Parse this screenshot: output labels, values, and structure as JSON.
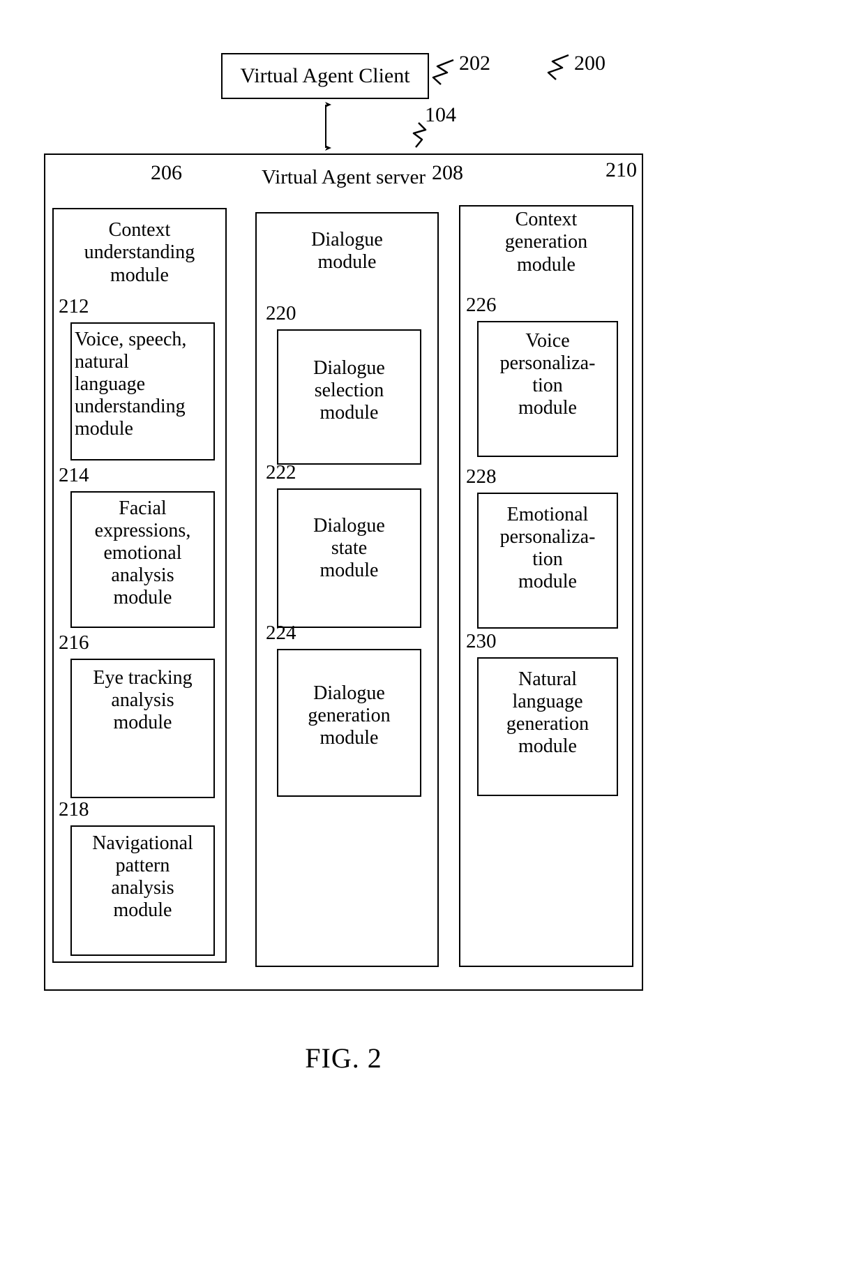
{
  "figure": {
    "caption": "FIG. 2",
    "system_ref": "200"
  },
  "client": {
    "label": "Virtual Agent Client",
    "ref": "202"
  },
  "link": {
    "ref": "104"
  },
  "server": {
    "title": "Virtual Agent server",
    "columns": [
      {
        "ref": "206",
        "title": "Context\nunderstanding\nmodule",
        "submodules": [
          {
            "ref": "212",
            "label": "Voice, speech,\nnatural\nlanguage\nunderstanding\nmodule"
          },
          {
            "ref": "214",
            "label": "Facial\nexpressions,\nemotional\nanalysis\nmodule"
          },
          {
            "ref": "216",
            "label": "Eye tracking\nanalysis\nmodule"
          },
          {
            "ref": "218",
            "label": "Navigational\npattern\nanalysis\nmodule"
          }
        ]
      },
      {
        "ref": "208",
        "title": "Dialogue\nmodule",
        "submodules": [
          {
            "ref": "220",
            "label": "Dialogue\nselection\nmodule"
          },
          {
            "ref": "222",
            "label": "Dialogue\nstate\nmodule"
          },
          {
            "ref": "224",
            "label": "Dialogue\ngeneration\nmodule"
          }
        ]
      },
      {
        "ref": "210",
        "title": "Context\ngeneration\nmodule",
        "submodules": [
          {
            "ref": "226",
            "label": "Voice\npersonaliza-\ntion\nmodule"
          },
          {
            "ref": "228",
            "label": "Emotional\npersonaliza-\ntion\nmodule"
          },
          {
            "ref": "230",
            "label": "Natural\nlanguage\ngeneration\nmodule"
          }
        ]
      }
    ]
  }
}
